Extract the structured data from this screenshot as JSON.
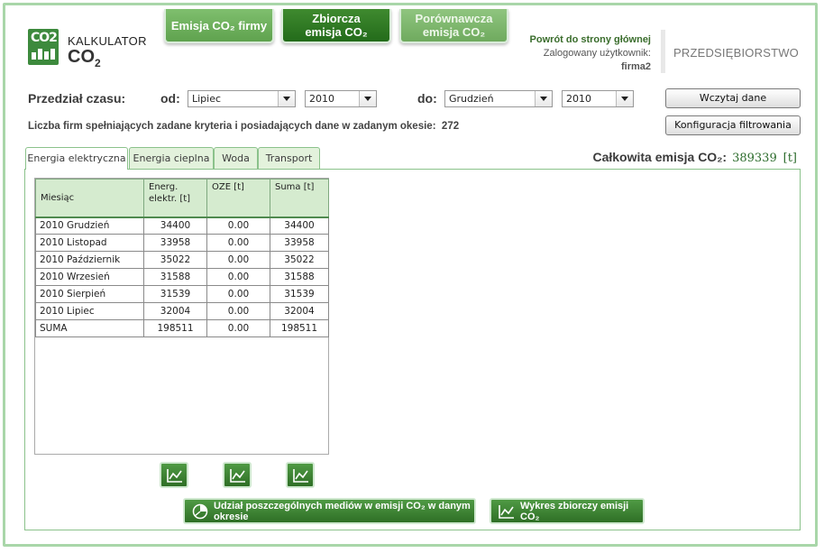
{
  "logo": {
    "line1": "KALKULATOR",
    "line2": "CO",
    "line2_sub": "2",
    "badge": "CO2"
  },
  "nav": [
    {
      "label": "Emisja CO₂ firmy"
    },
    {
      "label": "Zbiorcza emisja CO₂"
    },
    {
      "label": "Porównawcza emisja CO₂"
    }
  ],
  "header": {
    "back_link": "Powrót do strony głównej",
    "logged_label": "Zalogowany użytkownik:",
    "username": "firma2",
    "company_type": "PRZEDSIĘBIORSTWO"
  },
  "filter": {
    "period_label": "Przedział czasu:",
    "from_label": "od:",
    "from_month": "Lipiec",
    "from_year": "2010",
    "to_label": "do:",
    "to_month": "Grudzień",
    "to_year": "2010",
    "load_button": "Wczytaj dane",
    "config_button": "Konfiguracja filtrowania",
    "count_text": "Liczba firm spełniających zadane kryteria i posiadających dane w zadanym okesie:",
    "count_value": "272"
  },
  "tabs": [
    {
      "label": "Energia elektryczna",
      "active": true
    },
    {
      "label": "Energia cieplna",
      "active": false
    },
    {
      "label": "Woda",
      "active": false
    },
    {
      "label": "Transport",
      "active": false
    }
  ],
  "total": {
    "label": "Całkowita emisja CO₂:",
    "value": "389339",
    "unit": "[t]"
  },
  "table": {
    "headers": [
      "Miesiąc",
      "Energ. elektr. [t]",
      "OZE [t]",
      "Suma [t]"
    ],
    "rows": [
      [
        "2010 Grudzień",
        "34400",
        "0.00",
        "34400"
      ],
      [
        "2010 Listopad",
        "33958",
        "0.00",
        "33958"
      ],
      [
        "2010 Październik",
        "35022",
        "0.00",
        "35022"
      ],
      [
        "2010 Wrzesień",
        "31588",
        "0.00",
        "31588"
      ],
      [
        "2010 Sierpień",
        "31539",
        "0.00",
        "31539"
      ],
      [
        "2010 Lipiec",
        "32004",
        "0.00",
        "32004"
      ],
      [
        "SUMA",
        "198511",
        "0.00",
        "198511"
      ]
    ]
  },
  "icons": {
    "column_chart": "line-chart-icon",
    "pie": "pie-chart-icon"
  },
  "actions": {
    "share_button": "Udział poszczególnych mediów w emisji CO₂ w danym okresie",
    "summary_chart_button": "Wykres zbiorczy emisji CO₂"
  },
  "colors": {
    "accent": "#2f6f26",
    "tab_bg": "#e3f2dc",
    "border": "#8bc28b"
  }
}
